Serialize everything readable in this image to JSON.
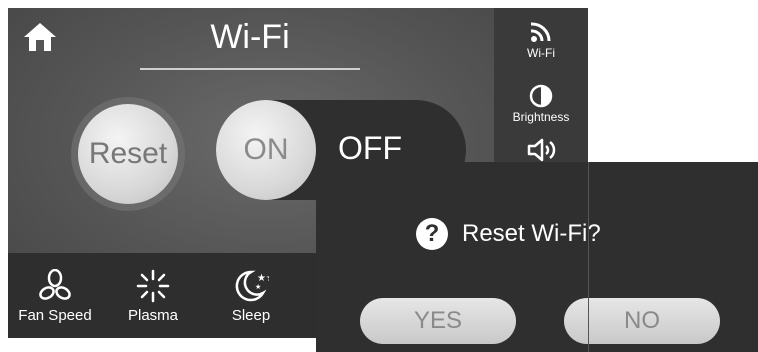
{
  "header": {
    "title": "Wi-Fi"
  },
  "main": {
    "reset_label": "Reset",
    "toggle": {
      "on_label": "ON",
      "off_label": "OFF",
      "state": "ON"
    }
  },
  "side_menu": {
    "items": [
      {
        "label": "Wi-Fi",
        "icon": "wifi-icon"
      },
      {
        "label": "Brightness",
        "icon": "brightness-icon"
      },
      {
        "label": "",
        "icon": "volume-icon"
      }
    ]
  },
  "bottom_bar": {
    "items": [
      {
        "label": "Fan Speed",
        "icon": "fan-icon"
      },
      {
        "label": "Plasma",
        "icon": "plasma-icon"
      },
      {
        "label": "Sleep",
        "icon": "sleep-moon-icon"
      }
    ]
  },
  "dialog": {
    "message": "Reset Wi-Fi?",
    "icon": "question-icon",
    "icon_glyph": "?",
    "yes_label": "YES",
    "no_label": "NO"
  },
  "colors": {
    "screen_bg": "#555555",
    "bar_bg": "#2e2e2e",
    "button_light": "#d8d8d8",
    "text_light": "#ffffff"
  }
}
